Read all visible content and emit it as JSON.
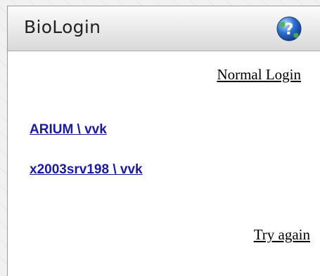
{
  "header": {
    "title": "BioLogin",
    "help_icon": "help-icon"
  },
  "links": {
    "normal_login": "Normal Login",
    "try_again": "Try again"
  },
  "accounts": [
    {
      "label": "ARIUM \\ vvk"
    },
    {
      "label": "x2003srv198 \\ vvk"
    }
  ],
  "colors": {
    "link_blue": "#1a1aa0",
    "help_icon_blue": "#2a6fd1",
    "help_icon_green": "#4caf50"
  }
}
